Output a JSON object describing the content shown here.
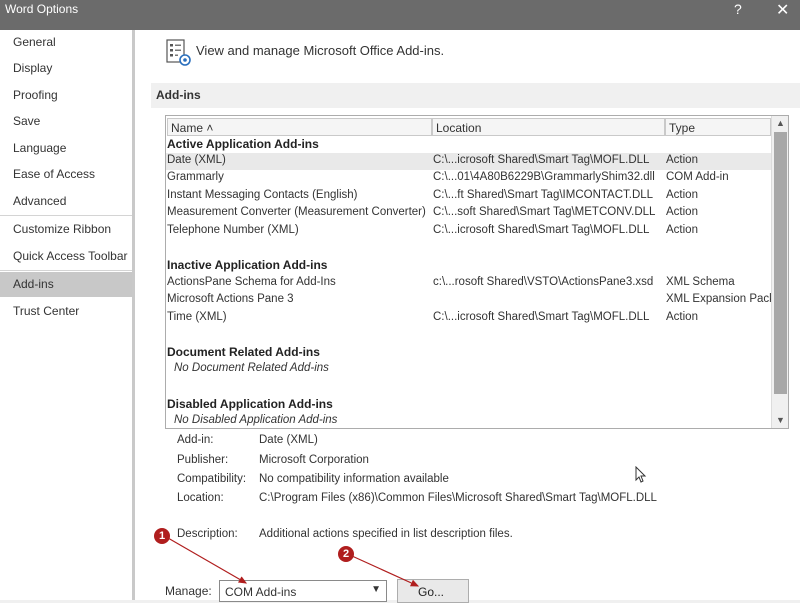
{
  "window": {
    "title": "Word Options",
    "help": "?",
    "close": "✕"
  },
  "sidebar": {
    "items": [
      {
        "label": "General"
      },
      {
        "label": "Display"
      },
      {
        "label": "Proofing"
      },
      {
        "label": "Save"
      },
      {
        "label": "Language"
      },
      {
        "label": "Ease of Access"
      },
      {
        "label": "Advanced"
      },
      {
        "label": "Customize Ribbon"
      },
      {
        "label": "Quick Access Toolbar"
      },
      {
        "label": "Add-ins"
      },
      {
        "label": "Trust Center"
      }
    ],
    "active": "Add-ins"
  },
  "header": {
    "text": "View and manage Microsoft Office Add-ins.",
    "icon": "addins-settings-icon"
  },
  "section": {
    "title": "Add-ins"
  },
  "table": {
    "columns": [
      "Name ˄",
      "Location",
      "Type"
    ],
    "groups": [
      {
        "title": "Active Application Add-ins",
        "rows": [
          {
            "name": "Date (XML)",
            "location": "C:\\...icrosoft Shared\\Smart Tag\\MOFL.DLL",
            "type": "Action"
          },
          {
            "name": "Grammarly",
            "location": "C:\\...01\\4A80B6229B\\GrammarlyShim32.dll",
            "type": "COM Add-in"
          },
          {
            "name": "Instant Messaging Contacts (English)",
            "location": "C:\\...ft Shared\\Smart Tag\\IMCONTACT.DLL",
            "type": "Action"
          },
          {
            "name": "Measurement Converter (Measurement Converter)",
            "location": "C:\\...soft Shared\\Smart Tag\\METCONV.DLL",
            "type": "Action"
          },
          {
            "name": "Telephone Number (XML)",
            "location": "C:\\...icrosoft Shared\\Smart Tag\\MOFL.DLL",
            "type": "Action"
          }
        ]
      },
      {
        "title": "Inactive Application Add-ins",
        "rows": [
          {
            "name": "ActionsPane Schema for Add-Ins",
            "location": "c:\\...rosoft Shared\\VSTO\\ActionsPane3.xsd",
            "type": "XML Schema"
          },
          {
            "name": "Microsoft Actions Pane 3",
            "location": "",
            "type": "XML Expansion Pack"
          },
          {
            "name": "Time (XML)",
            "location": "C:\\...icrosoft Shared\\Smart Tag\\MOFL.DLL",
            "type": "Action"
          }
        ]
      },
      {
        "title": "Document Related Add-ins",
        "empty": "No Document Related Add-ins"
      },
      {
        "title": "Disabled Application Add-ins",
        "empty": "No Disabled Application Add-ins"
      }
    ]
  },
  "details": {
    "addin": {
      "label": "Add-in:",
      "value": "Date (XML)"
    },
    "publisher": {
      "label": "Publisher:",
      "value": "Microsoft Corporation"
    },
    "compatibility": {
      "label": "Compatibility:",
      "value": "No compatibility information available"
    },
    "location": {
      "label": "Location:",
      "value": "C:\\Program Files (x86)\\Common Files\\Microsoft Shared\\Smart Tag\\MOFL.DLL"
    },
    "description": {
      "label": "Description:",
      "value": "Additional actions specified in list description files."
    }
  },
  "manage": {
    "label": "Manage:",
    "selected": "COM Add-ins",
    "go_label": "Go..."
  },
  "annotations": {
    "callout1": "1",
    "callout2": "2",
    "color": "#b01e1e"
  }
}
